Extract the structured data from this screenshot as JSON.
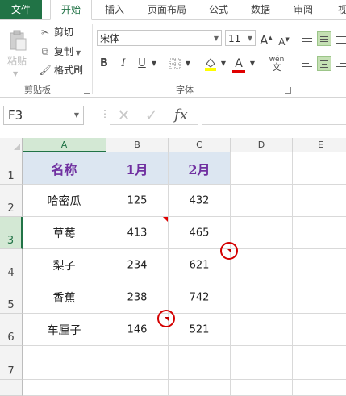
{
  "ribbon_tabs": [
    "文件",
    "开始",
    "插入",
    "页面布局",
    "公式",
    "数据",
    "审阅",
    "视"
  ],
  "clipboard": {
    "paste": "粘贴",
    "cut": "剪切",
    "copy": "复制",
    "format_painter": "格式刷",
    "group_label": "剪贴板"
  },
  "font": {
    "name": "宋体",
    "size": "11",
    "bold": "B",
    "italic": "I",
    "underline": "U",
    "grow": "A",
    "shrink": "A",
    "font_color": "A",
    "phonetic": "wén",
    "group_label": "字体",
    "accent_fill": "#ffff00",
    "accent_font": "#e00000"
  },
  "formula_bar": {
    "name_box": "F3",
    "fx": "fx",
    "formula": ""
  },
  "columns": [
    "A",
    "B",
    "C",
    "D",
    "E"
  ],
  "rows": [
    "1",
    "2",
    "3",
    "4",
    "5",
    "6",
    "7"
  ],
  "table": {
    "headers": [
      "名称",
      "1月",
      "2月"
    ],
    "rows": [
      [
        "哈密瓜",
        "125",
        "432"
      ],
      [
        "草莓",
        "413",
        "465"
      ],
      [
        "梨子",
        "234",
        "621"
      ],
      [
        "香蕉",
        "238",
        "742"
      ],
      [
        "车厘子",
        "146",
        "521"
      ]
    ]
  },
  "colors": {
    "excel_green": "#217346",
    "header_fill": "#dce6f1",
    "header_text": "#7030a0",
    "highlight_circle": "#d40000"
  }
}
